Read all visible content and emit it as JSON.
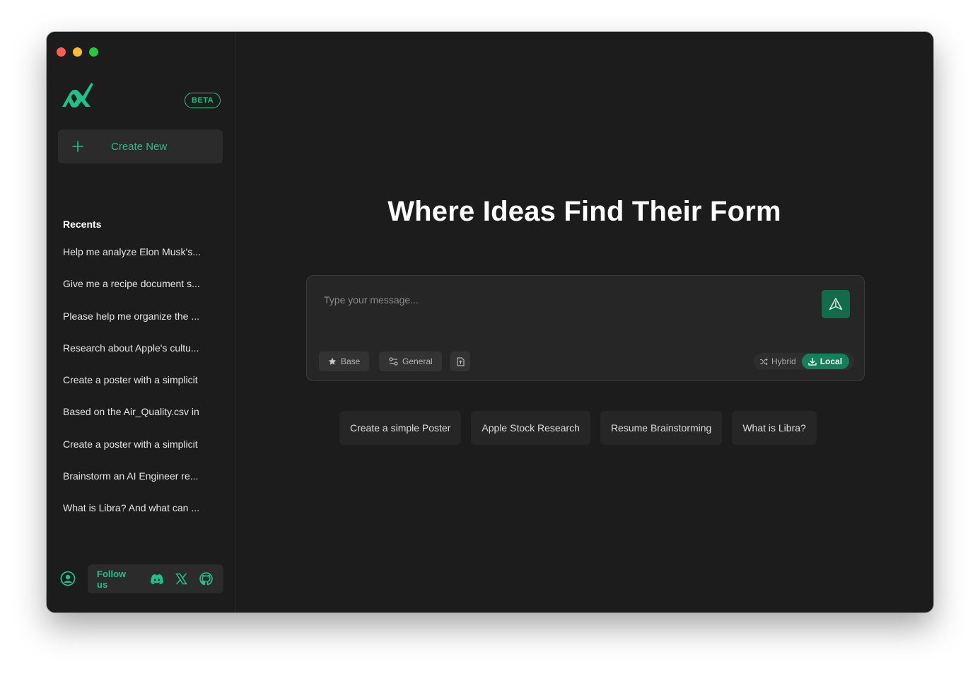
{
  "app": {
    "badge": "BETA",
    "accent_color": "#1fc08a",
    "logo_icon": "libra-logo-icon"
  },
  "sidebar": {
    "create_new_label": "Create New",
    "recents_title": "Recents",
    "recents": [
      "Help me analyze Elon Musk's...",
      "Give me a recipe document s...",
      "Please help me organize the ...",
      "Research about Apple's cultu...",
      "Create a poster with a simplicit",
      "Based on the Air_Quality.csv in",
      "Create a poster with a simplicit",
      "Brainstorm an AI Engineer re...",
      "What is Libra? And what can ..."
    ],
    "follow_label": "Follow us",
    "social_icons": [
      "discord-icon",
      "x-icon",
      "github-icon"
    ]
  },
  "main": {
    "title": "Where Ideas Find Their Form",
    "composer": {
      "placeholder": "Type your message...",
      "chips": {
        "base": "Base",
        "general": "General"
      },
      "modes": {
        "hybrid": "Hybrid",
        "local": "Local",
        "selected": "Local"
      }
    },
    "suggestions": [
      "Create a simple Poster",
      "Apple Stock Research",
      "Resume Brainstorming",
      "What is Libra?"
    ]
  }
}
